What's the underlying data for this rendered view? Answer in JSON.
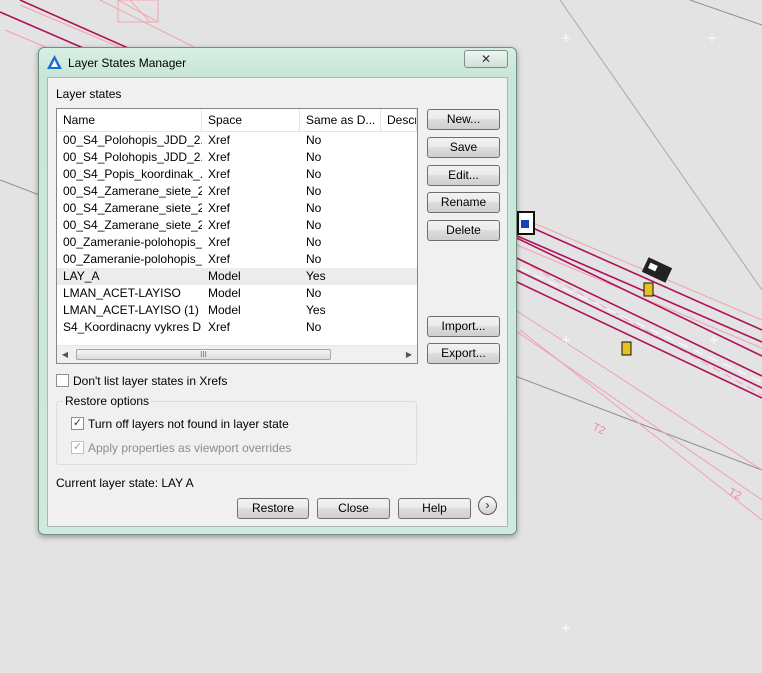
{
  "dialog": {
    "title": "Layer States Manager",
    "close_symbol": "✕",
    "layer_states_label": "Layer states",
    "columns": [
      "Name",
      "Space",
      "Same as D...",
      "Descri"
    ],
    "rows": [
      {
        "name": "00_S4_Polohopis_JDD_2...",
        "space": "Xref",
        "same": "No"
      },
      {
        "name": "00_S4_Polohopis_JDD_2...",
        "space": "Xref",
        "same": "No"
      },
      {
        "name": "00_S4_Popis_koordinak_...",
        "space": "Xref",
        "same": "No"
      },
      {
        "name": "00_S4_Zamerane_siete_2...",
        "space": "Xref",
        "same": "No"
      },
      {
        "name": "00_S4_Zamerane_siete_2...",
        "space": "Xref",
        "same": "No"
      },
      {
        "name": "00_S4_Zamerane_siete_2...",
        "space": "Xref",
        "same": "No"
      },
      {
        "name": "00_Zameranie-polohopis_...",
        "space": "Xref",
        "same": "No"
      },
      {
        "name": "00_Zameranie-polohopis_...",
        "space": "Xref",
        "same": "No"
      },
      {
        "name": "LAY_A",
        "space": "Model",
        "same": "Yes",
        "selected": true
      },
      {
        "name": "LMAN_ACET-LAYISO",
        "space": "Model",
        "same": "No"
      },
      {
        "name": "LMAN_ACET-LAYISO (1)",
        "space": "Model",
        "same": "Yes"
      },
      {
        "name": "S4_Koordinacny vykres D...",
        "space": "Xref",
        "same": "No"
      }
    ],
    "scroll_left": "◀",
    "scroll_right": "▶",
    "scroll_grip": "III",
    "buttons": {
      "new": "New...",
      "save": "Save",
      "edit": "Edit...",
      "rename": "Rename",
      "delete": "Delete",
      "import": "Import...",
      "export": "Export..."
    },
    "dont_list_xrefs": {
      "label": "Don't list layer states in Xrefs",
      "checked": false,
      "mark": ""
    },
    "restore_options": {
      "title": "Restore options",
      "turn_off": {
        "label": "Turn off layers not found in layer state",
        "checked": true,
        "mark": "✓"
      },
      "apply_overrides": {
        "label": "Apply properties as viewport overrides",
        "checked": true,
        "mark": "✓",
        "disabled": true
      }
    },
    "current_state": "Current layer state: LAY A",
    "footer": {
      "restore": "Restore",
      "close": "Close",
      "help": "Help",
      "expand": "›"
    }
  },
  "background_text": [
    "T2",
    "T2"
  ],
  "colors": {
    "dialog_frame": "#c9e6d8",
    "client": "#f0f0f0",
    "cad_line": "#b0105a",
    "cad_light_line": "#f2a0b0",
    "canvas": "#e3e3e3"
  }
}
